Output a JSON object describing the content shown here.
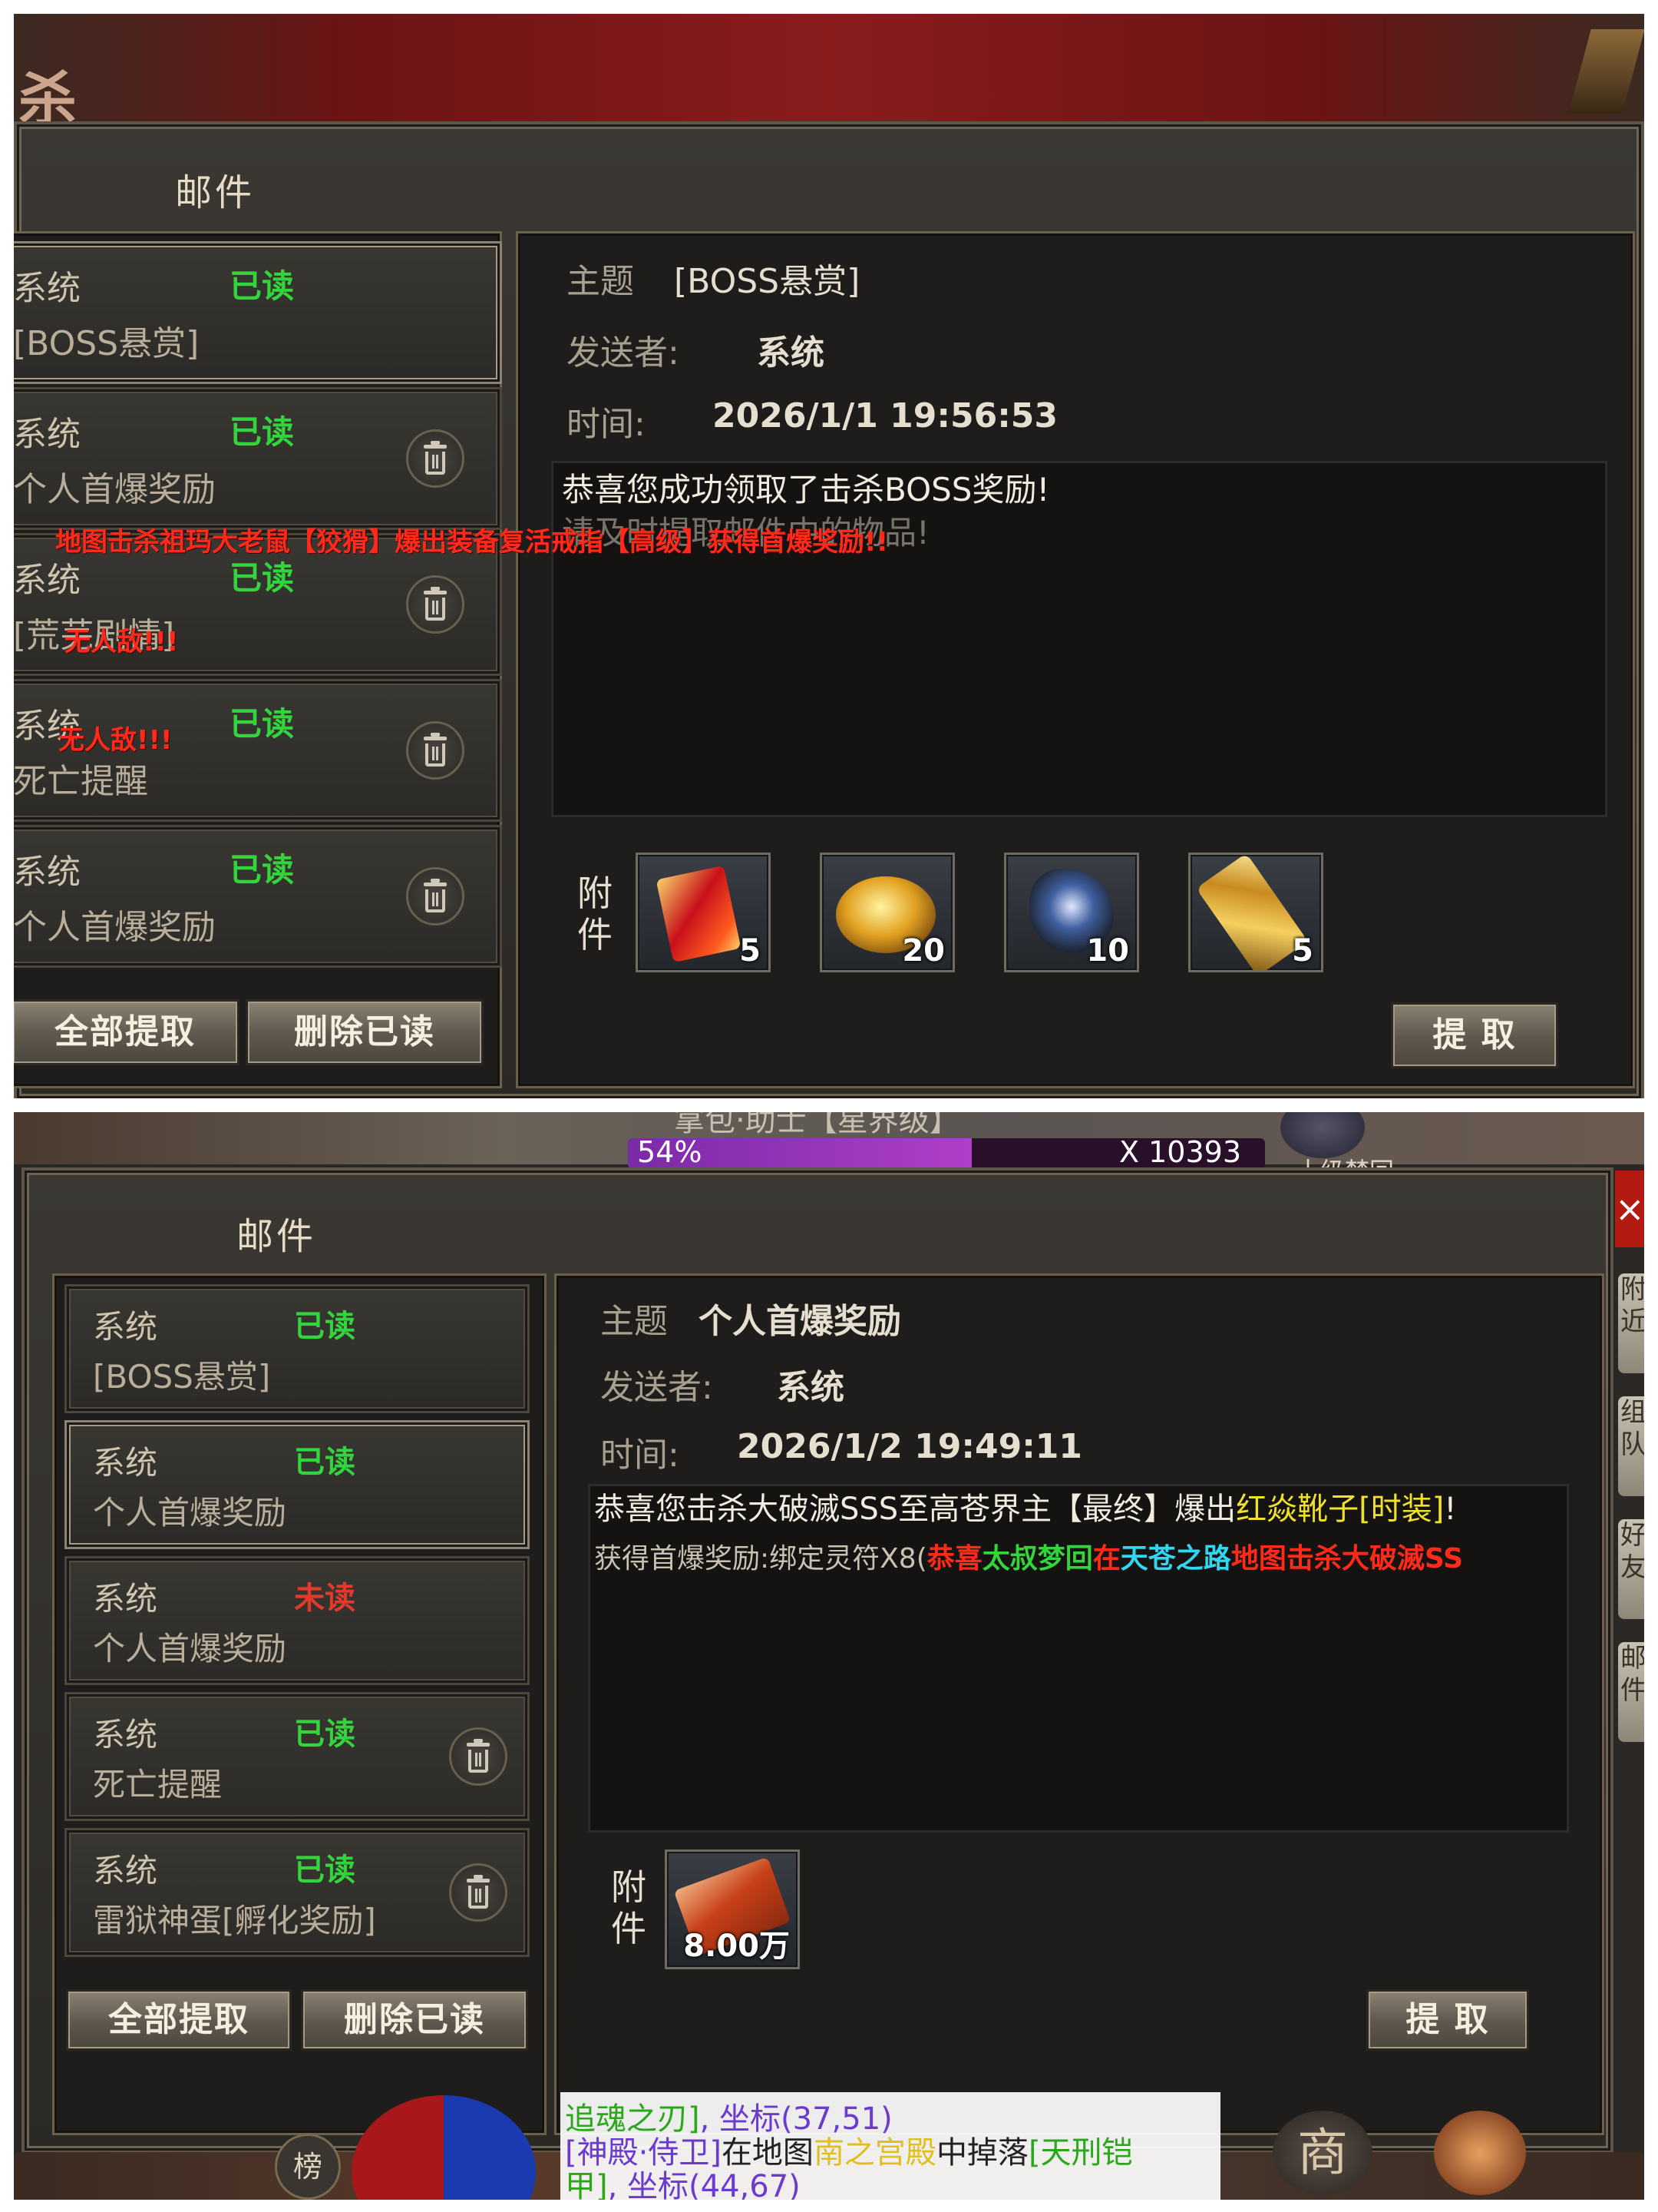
{
  "top": {
    "banner_glyph": "杀",
    "title": "邮件",
    "list": [
      {
        "sender": "系统",
        "status": "已读",
        "subject": "[BOSS悬赏]",
        "trash": false
      },
      {
        "sender": "系统",
        "status": "已读",
        "subject": "个人首爆奖励",
        "trash": true
      },
      {
        "sender": "系统",
        "status": "已读",
        "subject": "[荒芜剧情]",
        "trash": true
      },
      {
        "sender": "系统",
        "status": "已读",
        "subject": "死亡提醒",
        "trash": true
      },
      {
        "sender": "系统",
        "status": "已读",
        "subject": "个人首爆奖励",
        "trash": true
      }
    ],
    "btn_collect_all": "全部提取",
    "btn_delete_read": "删除已读",
    "subject_label": "主题",
    "subject_value": "[BOSS悬赏]",
    "sender_label": "发送者:",
    "sender_value": "系统",
    "time_label": "时间:",
    "time_value": "2026/1/1 19:56:53",
    "message_line1": "恭喜您成功领取了击杀BOSS奖励!",
    "message_line2": "请及时提取邮件中的物品!",
    "attach_label": "附件",
    "attachments": [
      {
        "icon": "red-envelope-icon",
        "qty": "5"
      },
      {
        "icon": "gold-ingot-icon",
        "qty": "20"
      },
      {
        "icon": "dark-gem-icon",
        "qty": "10"
      },
      {
        "icon": "gold-token-icon",
        "qty": "5"
      }
    ],
    "btn_collect": "提 取",
    "scroll_notice": "地图击杀祖玛大老鼠【狡猾】爆出装备复活戒指【高级】获得首爆奖励!!",
    "overlay1": "无人敌!!!",
    "overlay2": "无人敌!!!"
  },
  "bottom": {
    "hud_fragment": "拿包·助士【星界级】",
    "hud_progress": "54%",
    "hud_progress_value": 0.54,
    "hud_power": "X 10393",
    "hud_name_fragment": "十级梦回",
    "title": "邮件",
    "list": [
      {
        "sender": "系统",
        "status": "已读",
        "unread": false,
        "subject": "[BOSS悬赏]",
        "trash": false
      },
      {
        "sender": "系统",
        "status": "已读",
        "unread": false,
        "subject": "个人首爆奖励",
        "trash": false
      },
      {
        "sender": "系统",
        "status": "未读",
        "unread": true,
        "subject": "个人首爆奖励",
        "trash": false
      },
      {
        "sender": "系统",
        "status": "已读",
        "unread": false,
        "subject": "死亡提醒",
        "trash": true
      },
      {
        "sender": "系统",
        "status": "已读",
        "unread": false,
        "subject": "雷狱神蛋[孵化奖励]",
        "trash": true
      }
    ],
    "btn_collect_all": "全部提取",
    "btn_delete_read": "删除已读",
    "subject_label": "主题",
    "subject_value": "个人首爆奖励",
    "sender_label": "发送者:",
    "sender_value": "系统",
    "time_label": "时间:",
    "time_value": "2026/1/2 19:49:11",
    "message_line1_a": "恭喜您击杀大破滅SSS至高苍界主【最终】爆出",
    "message_line1_b": "红焱靴子[时装]",
    "message_line1_c": "!",
    "message_line2_a": "获得首爆奖励:绑定灵符X8(",
    "scroll_a": "恭喜",
    "scroll_b": "太叔梦回",
    "scroll_c": "在",
    "scroll_d": "天苍之路",
    "scroll_e": "地图击杀大破滅SS",
    "attach_label": "附件",
    "attachments": [
      {
        "icon": "talisman-stack-icon",
        "qty": "8.00万"
      }
    ],
    "btn_collect": "提 取",
    "side_tab1": "附近",
    "side_tab2": "组队",
    "side_tab3": "好友",
    "side_tab4": "邮件",
    "close_glyph": "×",
    "chat_line1_a": "追魂之刃]",
    "chat_line1_b": ", 坐标(37,51)",
    "chat_line2_a": "[神殿·侍卫]",
    "chat_line2_b": "在地图",
    "chat_line2_c": "南之宫殿",
    "chat_line2_d": "中掉落",
    "chat_line2_e": "[天刑铠",
    "chat_line3_a": "甲]",
    "chat_line3_b": ", 坐标(44,67)",
    "rank_glyph": "榜",
    "shop_glyph": "商"
  }
}
